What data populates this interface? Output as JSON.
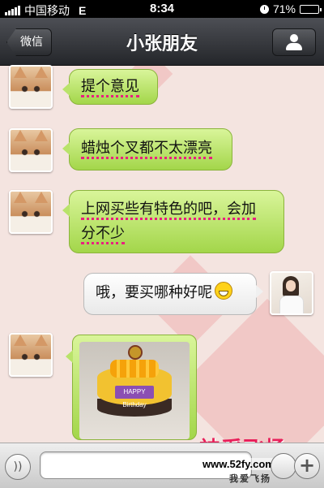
{
  "status_bar": {
    "carrier": "中国移动",
    "network": "E",
    "time": "8:34",
    "battery": "71%",
    "battery_level": 0.71
  },
  "nav": {
    "back_label": "微信",
    "title": "小张朋友"
  },
  "messages": [
    {
      "side": "left",
      "text": "提个意见"
    },
    {
      "side": "left",
      "text": "蜡烛个叉都不太漂亮"
    },
    {
      "side": "left",
      "text_line1": "上网买些有特色的吧，会加",
      "text_line2": "分不少"
    },
    {
      "side": "right",
      "text": "哦，要买哪种好呢"
    },
    {
      "side": "left",
      "type": "image",
      "cake_label": "HAPPY Birthday"
    }
  ],
  "watermark": {
    "title": "神采飞扬",
    "url": "www.52fy.com",
    "motto": "我爱飞扬"
  },
  "colors": {
    "sent_bubble": "#a3d64a",
    "received_bubble": "#ffffff",
    "nav_bar": "#2f3135",
    "underline": "#e8207f"
  }
}
